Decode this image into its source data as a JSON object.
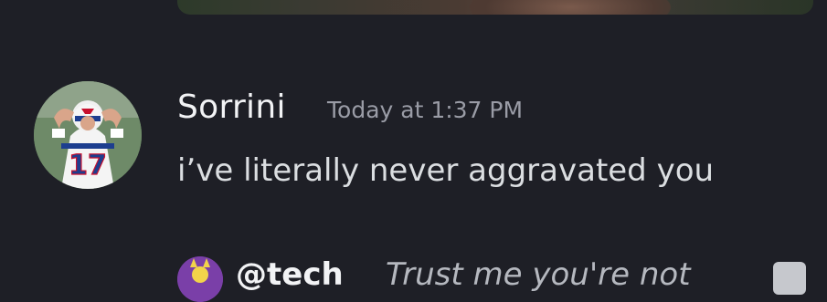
{
  "message": {
    "author": "Sorrini",
    "timestamp": "Today at 1:37 PM",
    "content": "i’ve literally never aggravated you",
    "avatar_jersey_number": "17"
  },
  "next_message": {
    "author_partial": "@tech",
    "content_partial": "Trust me you're not",
    "avatar_icon": "viking-mascot-icon",
    "trailing_icon": "file-icon"
  },
  "colors": {
    "background": "#1e1f26",
    "username": "#f2f3f5",
    "timestamp": "#9a9ca6",
    "message_text": "#dbdee1",
    "bills_blue": "#1d3e8f",
    "bills_red": "#c8102e"
  }
}
